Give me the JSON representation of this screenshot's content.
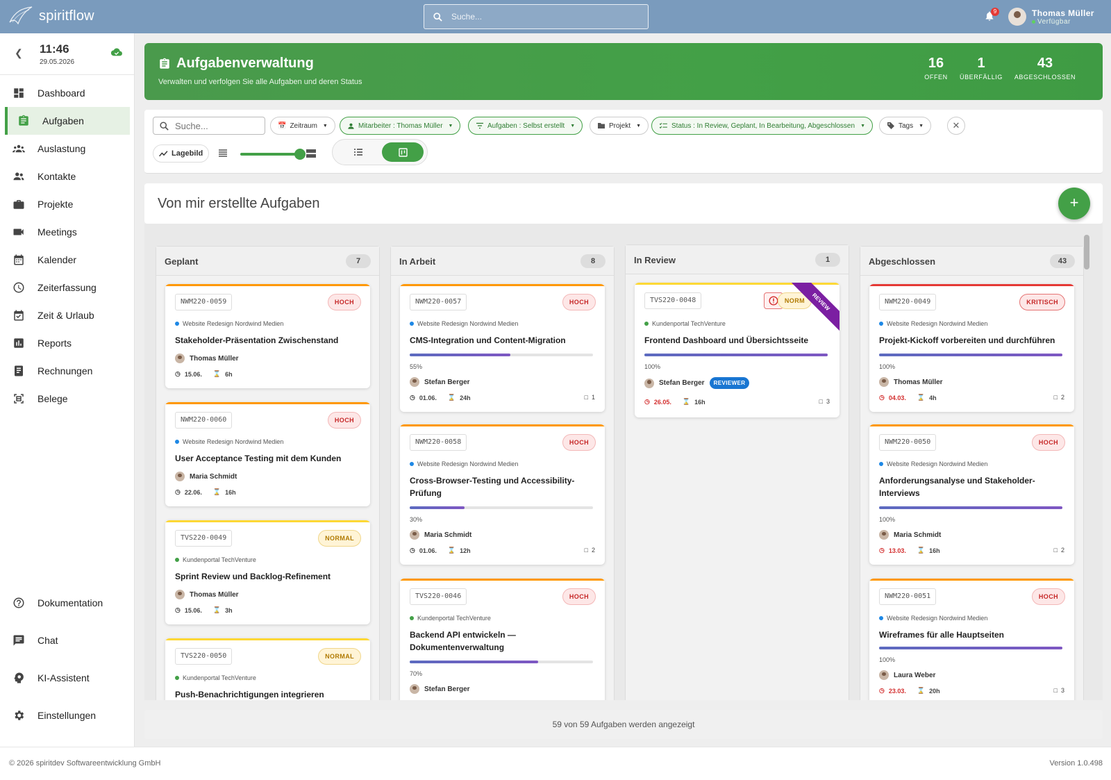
{
  "app": {
    "name": "spiritflow"
  },
  "topbar": {
    "search_placeholder": "Suche...",
    "notifications": "9",
    "user_name": "Thomas Müller",
    "user_status": "Verfügbar"
  },
  "clock": {
    "time": "11:46",
    "date": "29.05.2026"
  },
  "nav": {
    "items": [
      {
        "label": "Dashboard",
        "icon": "dashboard-icon"
      },
      {
        "label": "Aufgaben",
        "icon": "clipboard-icon",
        "active": true
      },
      {
        "label": "Auslastung",
        "icon": "people-icon"
      },
      {
        "label": "Kontakte",
        "icon": "contacts-icon"
      },
      {
        "label": "Projekte",
        "icon": "briefcase-icon"
      },
      {
        "label": "Meetings",
        "icon": "video-icon"
      },
      {
        "label": "Kalender",
        "icon": "calendar-icon"
      },
      {
        "label": "Zeiterfassung",
        "icon": "clock-icon"
      },
      {
        "label": "Zeit & Urlaub",
        "icon": "calendar-check-icon"
      },
      {
        "label": "Reports",
        "icon": "chart-icon"
      },
      {
        "label": "Rechnungen",
        "icon": "invoice-icon"
      },
      {
        "label": "Belege",
        "icon": "receipt-icon"
      }
    ],
    "bottom": [
      {
        "label": "Dokumentation",
        "icon": "help-icon"
      },
      {
        "label": "Chat",
        "icon": "chat-icon"
      },
      {
        "label": "KI-Assistent",
        "icon": "ai-assistant-icon"
      },
      {
        "label": "Einstellungen",
        "icon": "gear-icon"
      }
    ]
  },
  "hero": {
    "title": "Aufgabenverwaltung",
    "subtitle": "Verwalten und verfolgen Sie alle Aufgaben und deren Status",
    "stats": [
      {
        "value": "16",
        "label": "OFFEN"
      },
      {
        "value": "1",
        "label": "ÜBERFÄLLIG"
      },
      {
        "value": "43",
        "label": "ABGESCHLOSSEN"
      }
    ]
  },
  "filters": {
    "search_placeholder": "Suche...",
    "zeitraum": "Zeitraum",
    "mitarbeiter": "Mitarbeiter : Thomas Müller",
    "aufgaben": "Aufgaben : Selbst erstellt",
    "projekt": "Projekt",
    "status": "Status : In Review, Geplant, In Bearbeitung, Abgeschlossen",
    "tags": "Tags",
    "lagebild": "Lagebild",
    "density_level": 1.0
  },
  "section": {
    "title": "Von mir erstellte Aufgaben"
  },
  "colors": {
    "accent": "#43a047",
    "high": "#ff9800",
    "normal": "#fdd835",
    "critical": "#e53935",
    "progress": "#5c6bc0",
    "review": "#7b1fa2"
  },
  "columns": [
    {
      "title": "Geplant",
      "count": "7",
      "cards": [
        {
          "id": "NWM220-0059",
          "priority": "HOCH",
          "project": "Website Redesign Nordwind Medien",
          "title": "Stakeholder-Präsentation Zwischenstand",
          "person": "Thomas Müller",
          "date": "15.06.",
          "hours": "6h"
        },
        {
          "id": "NWM220-0060",
          "priority": "HOCH",
          "project": "Website Redesign Nordwind Medien",
          "title": "User Acceptance Testing mit dem Kunden",
          "person": "Maria Schmidt",
          "date": "22.06.",
          "hours": "16h"
        },
        {
          "id": "TVS220-0049",
          "priority": "NORMAL",
          "project": "Kundenportal TechVenture",
          "title": "Sprint Review und Backlog-Refinement",
          "person": "Thomas Müller",
          "date": "15.06.",
          "hours": "3h"
        },
        {
          "id": "TVS220-0050",
          "priority": "NORMAL",
          "project": "Kundenportal TechVenture",
          "title": "Push-Benachrichtigungen integrieren"
        }
      ]
    },
    {
      "title": "In Arbeit",
      "count": "8",
      "cards": [
        {
          "id": "NWM220-0057",
          "priority": "HOCH",
          "project": "Website Redesign Nordwind Medien",
          "title": "CMS-Integration und Content-Migration",
          "progress": 55,
          "progress_label": "55%",
          "person": "Stefan Berger",
          "date": "01.06.",
          "hours": "24h",
          "comments": "1"
        },
        {
          "id": "NWM220-0058",
          "priority": "HOCH",
          "project": "Website Redesign Nordwind Medien",
          "title": "Cross-Browser-Testing und Accessibility-Prüfung",
          "progress": 30,
          "progress_label": "30%",
          "person": "Maria Schmidt",
          "date": "01.06.",
          "hours": "12h",
          "comments": "2"
        },
        {
          "id": "TVS220-0046",
          "priority": "HOCH",
          "project": "Kundenportal TechVenture",
          "title": "Backend API entwickeln — Dokumentenverwaltung",
          "progress": 70,
          "progress_label": "70%",
          "person": "Stefan Berger"
        }
      ]
    },
    {
      "title": "In Review",
      "count": "1",
      "cards": [
        {
          "id": "TVS220-0048",
          "priority": "NORMAL",
          "priority_short": "NORM",
          "ribbon": "REVIEW",
          "project": "Kundenportal TechVenture",
          "title": "Frontend Dashboard und Übersichtsseite",
          "progress": 100,
          "progress_label": "100%",
          "person": "Stefan Berger",
          "badge": "REVIEWER",
          "date": "26.05.",
          "hours": "16h",
          "comments": "3"
        }
      ]
    },
    {
      "title": "Abgeschlossen",
      "count": "43",
      "cards": [
        {
          "id": "NWM220-0049",
          "priority": "KRITISCH",
          "project": "Website Redesign Nordwind Medien",
          "title": "Projekt-Kickoff vorbereiten und durchführen",
          "progress": 100,
          "progress_label": "100%",
          "person": "Thomas Müller",
          "date": "04.03.",
          "hours": "4h",
          "comments": "2"
        },
        {
          "id": "NWM220-0050",
          "priority": "HOCH",
          "project": "Website Redesign Nordwind Medien",
          "title": "Anforderungsanalyse und Stakeholder-Interviews",
          "progress": 100,
          "progress_label": "100%",
          "person": "Maria Schmidt",
          "date": "13.03.",
          "hours": "16h",
          "comments": "2"
        },
        {
          "id": "NWM220-0051",
          "priority": "HOCH",
          "project": "Website Redesign Nordwind Medien",
          "title": "Wireframes für alle Hauptseiten",
          "progress": 100,
          "progress_label": "100%",
          "person": "Laura Weber",
          "date": "23.03.",
          "hours": "20h",
          "comments": "3"
        }
      ]
    }
  ],
  "footer_count": "59 von 59 Aufgaben werden angezeigt",
  "footer": {
    "copyright": "© 2026 spiritdev Softwareentwicklung GmbH",
    "version": "Version 1.0.498"
  }
}
